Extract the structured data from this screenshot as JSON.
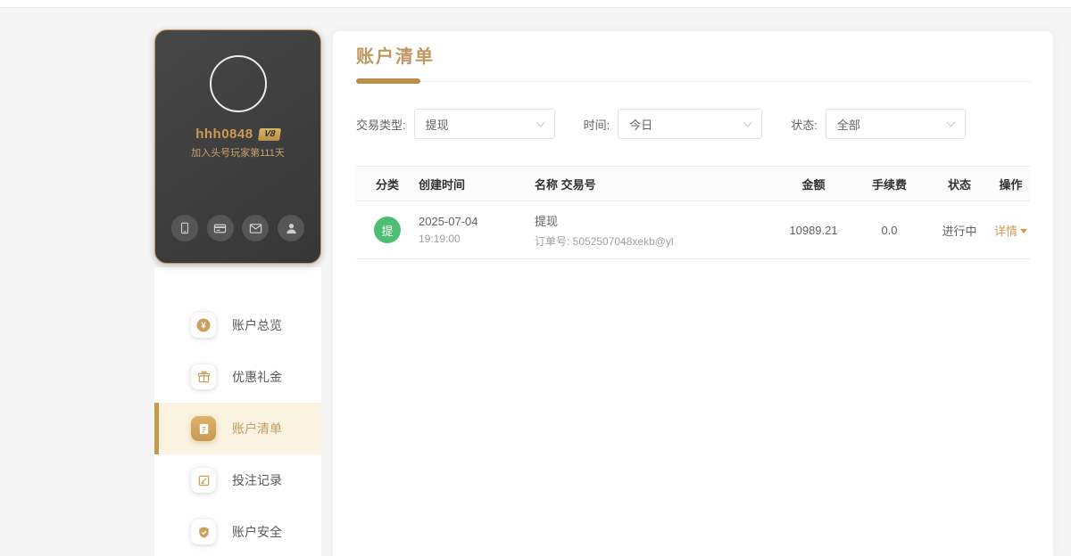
{
  "profile": {
    "username": "hhh0848",
    "vip_badge": "V8",
    "join_text": "加入头号玩家第111天",
    "quick_icons": [
      "phone-icon",
      "bank-card-icon",
      "mail-icon",
      "agent-icon"
    ]
  },
  "sidebar": {
    "items": [
      {
        "label": "账户总览",
        "active": false
      },
      {
        "label": "优惠礼金",
        "active": false
      },
      {
        "label": "账户清单",
        "active": true
      },
      {
        "label": "投注记录",
        "active": false
      },
      {
        "label": "账户安全",
        "active": false
      }
    ]
  },
  "main": {
    "title": "账户清单",
    "filters": {
      "type": {
        "label": "交易类型:",
        "value": "提现"
      },
      "time": {
        "label": "时间:",
        "value": "今日"
      },
      "status": {
        "label": "状态:",
        "value": "全部"
      }
    },
    "table": {
      "headers": [
        "分类",
        "创建时间",
        "名称 交易号",
        "金额",
        "手续费",
        "状态",
        "操作"
      ],
      "row": {
        "badge": "提",
        "date": "2025-07-04",
        "time": "19:19:00",
        "name": "提现",
        "order": "订单号: 5052507048xekb@yl",
        "amount": "10989.21",
        "fee": "0.0",
        "status": "进行中",
        "action": "详情"
      }
    }
  },
  "icons": {
    "coin_symbol": "¥"
  },
  "colors": {
    "gold_accent": "#bf9760",
    "active_item_bg": "#faf3e2",
    "active_bar": "#c49a53",
    "green_badge": "#4fbe75",
    "detail_link": "#d09a55",
    "card_border": "#c9975a"
  }
}
